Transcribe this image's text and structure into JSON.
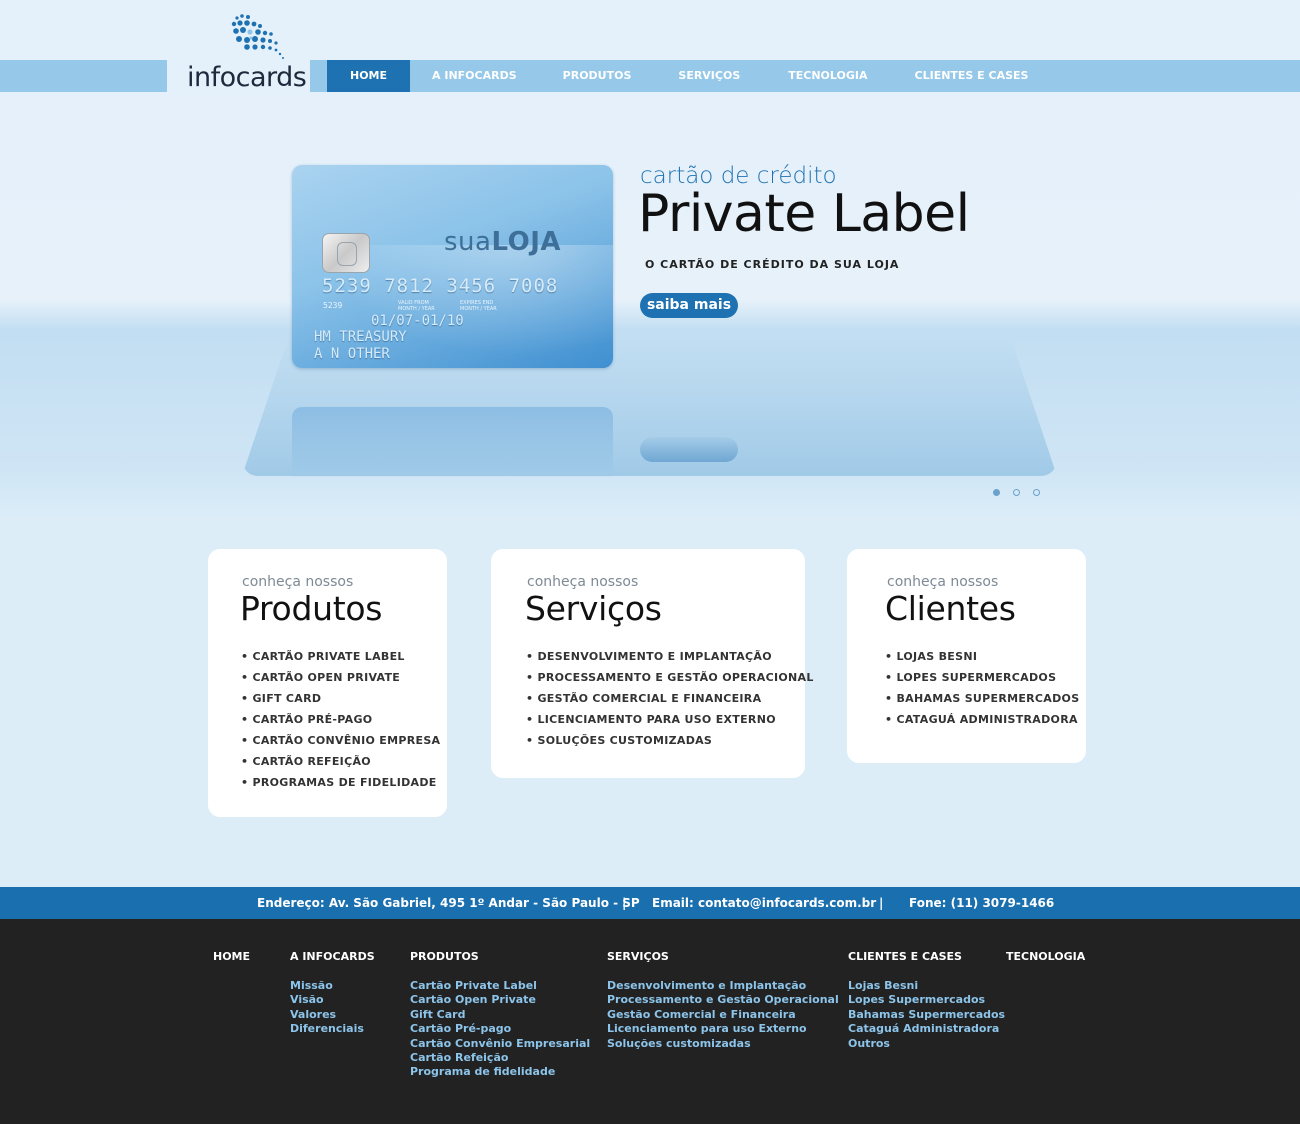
{
  "brand": {
    "logo_text": "infocards"
  },
  "nav": {
    "items": [
      {
        "label": "HOME",
        "active": true
      },
      {
        "label": "A INFOCARDS"
      },
      {
        "label": "PRODUTOS"
      },
      {
        "label": "SERVIÇOS"
      },
      {
        "label": "TECNOLOGIA"
      },
      {
        "label": "CLIENTES E CASES"
      }
    ]
  },
  "hero": {
    "subtitle": "cartão de crédito",
    "title": "Private Label",
    "tagline": "O CARTÃO DE CRÉDITO DA SUA LOJA",
    "button_label": "saiba mais",
    "card": {
      "brand_light": "sua",
      "brand_bold": "LOJA",
      "number": "5239 7812 3456 7008",
      "small_number": "5239",
      "valid_label": "VALID FROM MONTH / YEAR",
      "expires_label": "EXPIRES END MONTH / YEAR",
      "dates": "01/07-01/10",
      "holder_line1": "HM TREASURY",
      "holder_line2": "A N OTHER"
    },
    "slides": {
      "count": 3,
      "active": 0
    }
  },
  "boxes": {
    "produtos": {
      "pre": "conheça nossos",
      "title": "Produtos",
      "items": [
        "Cartão Private Label",
        "Cartão Open Private",
        "Gift Card",
        "Cartão Pré-pago",
        "Cartão Convênio Empresa",
        "Cartão Refeição",
        "Programas de Fidelidade"
      ]
    },
    "servicos": {
      "pre": "conheça nossos",
      "title": "Serviços",
      "items": [
        "Desenvolvimento e Implantação",
        "Processamento e Gestão Operacional",
        "Gestão Comercial e Financeira",
        "Licenciamento para uso Externo",
        "Soluções Customizadas"
      ]
    },
    "clientes": {
      "pre": "conheça nossos",
      "title": "Clientes",
      "items": [
        "Lojas Besni",
        "Lopes Supermercados",
        "Bahamas Supermercados",
        "Cataguá Administradora"
      ]
    }
  },
  "contact": {
    "address": "Endereço: Av. São Gabriel, 495 1º Andar - São Paulo - SP",
    "separator": "|",
    "email": "Email: contato@infocards.com.br",
    "phone": "Fone: (11) 3079-1466"
  },
  "footer": {
    "home": {
      "heading": "HOME"
    },
    "infocards": {
      "heading": "A INFOCARDS",
      "links": [
        "Missão",
        "Visão",
        "Valores",
        "Diferenciais"
      ]
    },
    "produtos": {
      "heading": "PRODUTOS",
      "links": [
        "Cartão Private Label",
        "Cartão Open Private",
        "Gift Card",
        "Cartão Pré-pago",
        "Cartão Convênio Empresarial",
        "Cartão Refeição",
        "Programa de fidelidade"
      ]
    },
    "servicos": {
      "heading": "SERVIÇOS",
      "links": [
        "Desenvolvimento e Implantação",
        "Processamento e Gestão Operacional",
        "Gestão Comercial e Financeira",
        "Licenciamento para uso Externo",
        "Soluções customizadas"
      ]
    },
    "clientes": {
      "heading": "CLIENTES E CASES",
      "links": [
        "Lojas Besni",
        "Lopes Supermercados",
        "Bahamas Supermercados",
        "Cataguá Administradora",
        "Outros"
      ]
    },
    "tecnologia": {
      "heading": "TECNOLOGIA"
    }
  },
  "colors": {
    "accent": "#1f72b1",
    "nav_bar": "#95c8e9",
    "footer_bg": "#222222",
    "footer_link": "#8cc4ea"
  }
}
